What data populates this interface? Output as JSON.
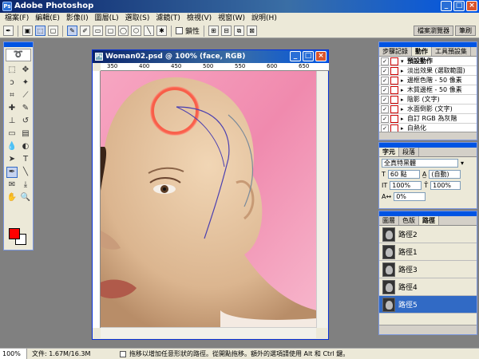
{
  "app": {
    "title": "Adobe Photoshop"
  },
  "menu": [
    "檔案(F)",
    "編輯(E)",
    "影像(I)",
    "圖層(L)",
    "選取(S)",
    "濾鏡(T)",
    "檢視(V)",
    "視窗(W)",
    "說明(H)"
  ],
  "options_bar": {
    "checkbox_label": "鎖性"
  },
  "palette_well": {
    "tabs": [
      "檔案瀏覽器",
      "筆刷"
    ]
  },
  "document": {
    "title": "Woman02.psd @ 100% (face, RGB)",
    "ruler_labels": [
      "350",
      "400",
      "450",
      "500",
      "550",
      "600",
      "650"
    ]
  },
  "actions_panel": {
    "tabs": [
      "步驟記錄",
      "動作",
      "工具預設集"
    ],
    "items": [
      {
        "label": "預設動作",
        "kind": "folder"
      },
      {
        "label": "淡出效果 (選取範圍)",
        "kind": "action"
      },
      {
        "label": "邊框色階 - 50 像素",
        "kind": "action"
      },
      {
        "label": "木質邊框 - 50 像素",
        "kind": "action"
      },
      {
        "label": "陰影 (文字)",
        "kind": "action"
      },
      {
        "label": "水面倒影 (文字)",
        "kind": "action"
      },
      {
        "label": "自訂 RGB 為灰階",
        "kind": "action"
      },
      {
        "label": "白熱化",
        "kind": "action"
      }
    ]
  },
  "character_panel": {
    "tabs": [
      "字元",
      "段落"
    ],
    "font_family": "全真特黑體",
    "font_size": "60 點",
    "leading": "(自動)",
    "vertical_scale": "100%",
    "horizontal_scale": "100%",
    "tracking": "0%"
  },
  "paths_panel": {
    "tabs": [
      "圖層",
      "色版",
      "路徑"
    ],
    "items": [
      "路徑2",
      "路徑1",
      "路徑3",
      "路徑4",
      "路徑5"
    ],
    "selected_index": 4
  },
  "status_bar": {
    "zoom": "100%",
    "doc_size": "文件: 1.67M/16.3M",
    "hint": "拖移以增加任意形狀的路徑。從開點拖移。額外的選項請使用 Alt 和 Ctrl 鍵。"
  },
  "colors": {
    "foreground": "#ff0000",
    "background": "#ffffff",
    "title_blue": "#0054e3",
    "selection": "#316ac5"
  }
}
